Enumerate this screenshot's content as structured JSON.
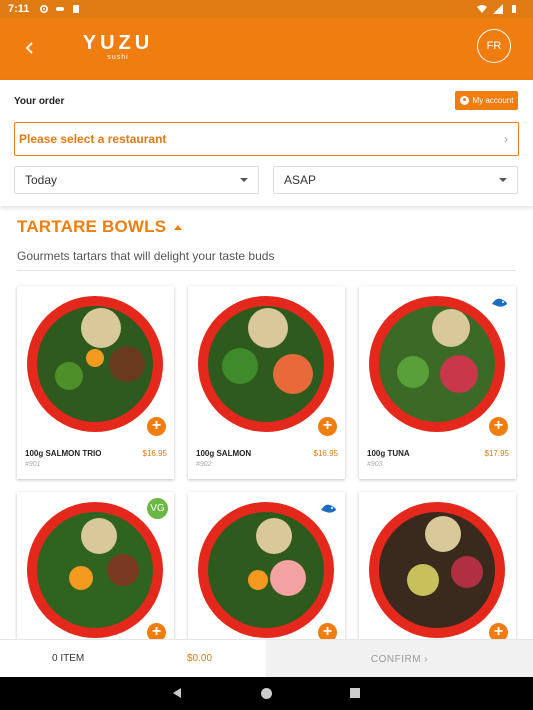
{
  "status_bar": {
    "time": "7:11"
  },
  "header": {
    "back_icon": "chevron-left-icon",
    "logo_brand": "YUZU",
    "logo_sub": "sushi",
    "avatar_initials": "FR"
  },
  "order": {
    "label": "Your order",
    "account_button": "My account",
    "restaurant_placeholder": "Please select a restaurant",
    "date_value": "Today",
    "time_value": "ASAP"
  },
  "section": {
    "title": "TARTARE BOWLS",
    "description": "Gourmets tartars that will delight your taste buds"
  },
  "products": [
    {
      "name": "100g SALMON TRIO",
      "price": "$16.95",
      "code": "#901",
      "badge": ""
    },
    {
      "name": "100g SALMON",
      "price": "$16.95",
      "code": "#902",
      "badge": ""
    },
    {
      "name": "100g TUNA",
      "price": "$17.95",
      "code": "#903",
      "badge": "fish-icon"
    },
    {
      "name": "",
      "price": "",
      "code": "",
      "badge_label": "VG"
    },
    {
      "name": "",
      "price": "",
      "code": "",
      "badge": "fish-icon"
    },
    {
      "name": "",
      "price": "",
      "code": "",
      "badge": ""
    }
  ],
  "add_label": "+",
  "cart": {
    "item_count": "0 ITEM",
    "total": "$0.00",
    "confirm_label": "CONFIRM ›"
  },
  "colors": {
    "brand_orange": "#ef7d10",
    "bowl_red": "#e4281b",
    "vegan_green": "#6ab744",
    "fish_blue": "#1c6fbf"
  }
}
